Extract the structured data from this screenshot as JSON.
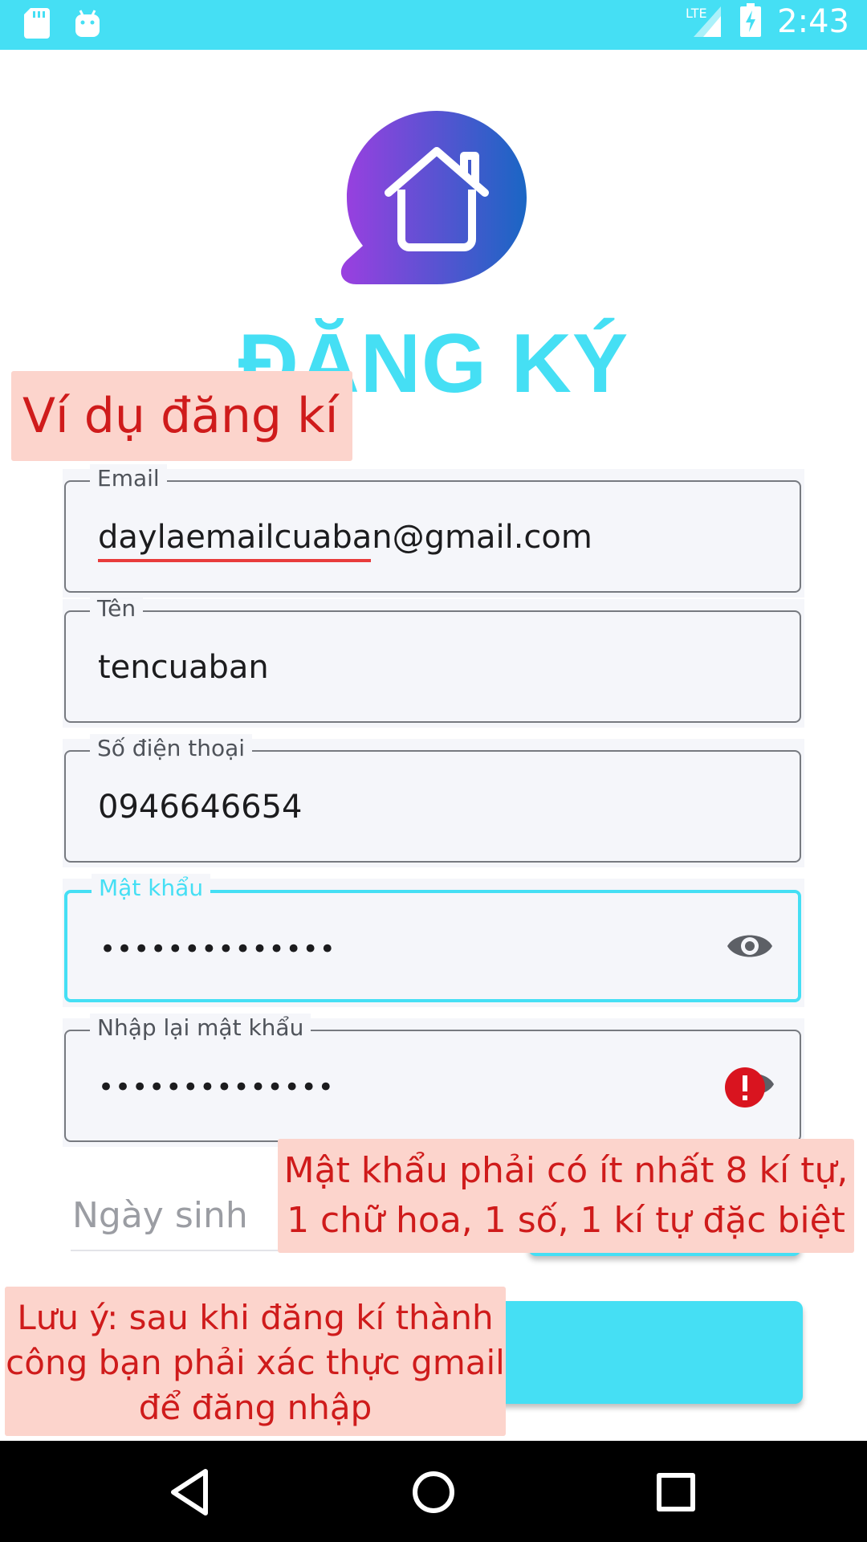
{
  "status_bar": {
    "time": "2:43",
    "network": "LTE",
    "icons": [
      "sd-card-icon",
      "android-icon",
      "signal-icon",
      "battery-charging-icon"
    ]
  },
  "title": "ĐĂNG KÝ",
  "form": {
    "email": {
      "label": "Email",
      "value": "daylaemailcuaban@gmail.com"
    },
    "name": {
      "label": "Tên",
      "value": "tencuaban"
    },
    "phone": {
      "label": "Số điện thoại",
      "value": "0946646654"
    },
    "password": {
      "label": "Mật khẩu",
      "value": "••••••••••••••"
    },
    "confirm_password": {
      "label": "Nhập lại mật khẩu",
      "value": "••••••••••••••"
    },
    "birth_date": {
      "placeholder": "Ngày sinh"
    }
  },
  "annotations": {
    "example": "Ví dụ đăng kí",
    "password_rule_line1": "Mật khẩu phải có ít nhất 8 kí tự,",
    "password_rule_line2": "1 chữ hoa, 1 số, 1 kí tự đặc biệt",
    "note_line1": "Lưu ý: sau khi đăng kí thành",
    "note_line2": "công bạn phải xác thực gmail",
    "note_line3": "để đăng nhập"
  },
  "colors": {
    "accent": "#45dff4",
    "annotation_bg": "#fcd4cc",
    "annotation_text": "#cf1b1b",
    "logo_gradient": [
      "#9b3fe0",
      "#1a66c4"
    ]
  }
}
